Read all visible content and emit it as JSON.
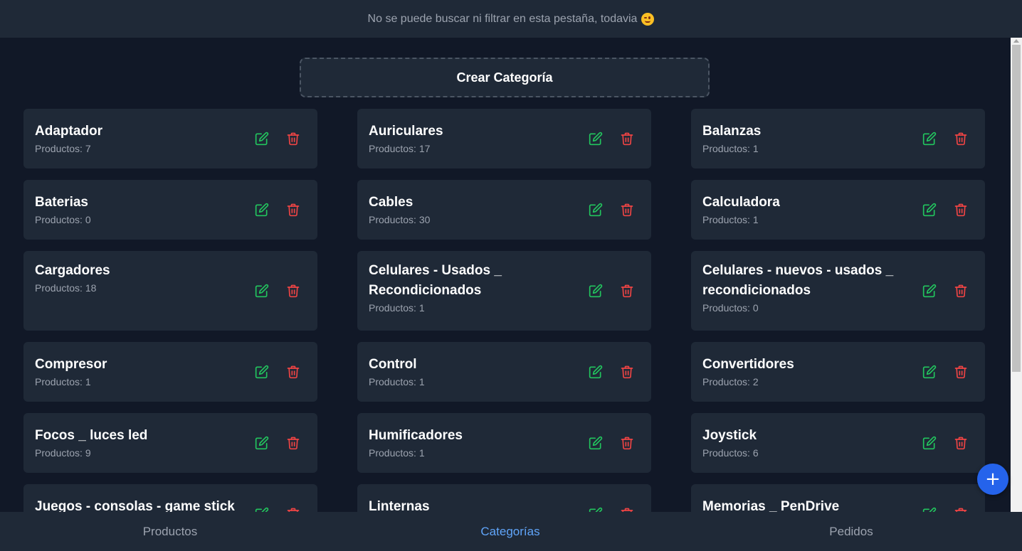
{
  "topbar": {
    "notice": "No se puede buscar ni filtrar en esta pestaña, todavia",
    "emoji": "winking-face"
  },
  "create_button_label": "Crear Categoría",
  "count_prefix": "Productos: ",
  "categories": [
    {
      "name": "Adaptador",
      "count": "7"
    },
    {
      "name": "Auriculares",
      "count": "17"
    },
    {
      "name": "Balanzas",
      "count": "1"
    },
    {
      "name": "Baterias",
      "count": "0"
    },
    {
      "name": "Cables",
      "count": "30"
    },
    {
      "name": "Calculadora",
      "count": "1"
    },
    {
      "name": "Cargadores",
      "count": "18"
    },
    {
      "name": "Celulares - Usados _ Recondicionados",
      "count": "1"
    },
    {
      "name": "Celulares - nuevos - usados _ recondicionados",
      "count": "0"
    },
    {
      "name": "Compresor",
      "count": "1"
    },
    {
      "name": "Control",
      "count": "1"
    },
    {
      "name": "Convertidores",
      "count": "2"
    },
    {
      "name": "Focos _ luces led",
      "count": "9"
    },
    {
      "name": "Humificadores",
      "count": "1"
    },
    {
      "name": "Joystick",
      "count": "6"
    },
    {
      "name": "Juegos - consolas - game stick",
      "count": ""
    },
    {
      "name": "Linternas",
      "count": ""
    },
    {
      "name": "Memorias _ PenDrive",
      "count": ""
    }
  ],
  "fab": {
    "icon": "plus-icon",
    "label": "+"
  },
  "nav": {
    "items": [
      {
        "label": "Productos",
        "active": false
      },
      {
        "label": "Categorías",
        "active": true
      },
      {
        "label": "Pedidos",
        "active": false
      }
    ]
  },
  "colors": {
    "background": "#111827",
    "card": "#1f2937",
    "edit": "#22c55e",
    "delete": "#ef4444",
    "accent": "#2563eb",
    "active_nav": "#60a5fa"
  }
}
